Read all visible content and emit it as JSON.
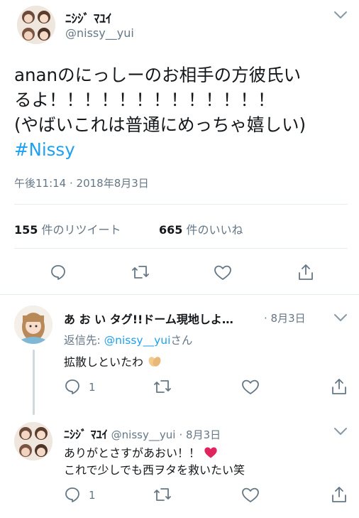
{
  "main_tweet": {
    "display_name": "ﾆｼｼﾞ ﾏﾕｲ",
    "handle": "@nissy__yui",
    "text_line1": "ananのにっしーのお相手の方彼氏い",
    "text_line2": "るよ！！！！！！！！！！！！！",
    "text_line3": "(やばいこれは普通にめっちゃ嬉しい)",
    "hashtag": "#Nissy",
    "timestamp": "午後11:14 · 2018年8月3日",
    "retweets_count": "155",
    "retweets_label": "件のリツイート",
    "likes_count": "665",
    "likes_label": "件のいいね",
    "icons": [
      "chevron-down-icon",
      "reply-icon",
      "retweet-icon",
      "like-icon",
      "share-icon"
    ]
  },
  "replies": [
    {
      "display_name": "あ お い タグ!!ドーム現地しよ…",
      "date": "· 8月3日",
      "reply_to_prefix": "返信先: ",
      "reply_to_handle": "@nissy__yui",
      "reply_to_suffix": "さん",
      "text": "拡散しといたわ",
      "emoji": "praying-hands-icon",
      "reply_count": "1"
    },
    {
      "display_name": "ﾆｼｼﾞ ﾏﾕｲ",
      "handle": "@nissy__yui",
      "date": "· 8月3日",
      "text_line1": "ありがとさすがあおい！！",
      "emoji": "red-heart-icon",
      "text_line2": "これで少しでも西ヲタを救いたい笑",
      "reply_count": "1"
    }
  ],
  "colors": {
    "accent": "#1da1f2",
    "muted": "#657786",
    "divider": "#e6ecf0",
    "heart": "#e0245e"
  }
}
